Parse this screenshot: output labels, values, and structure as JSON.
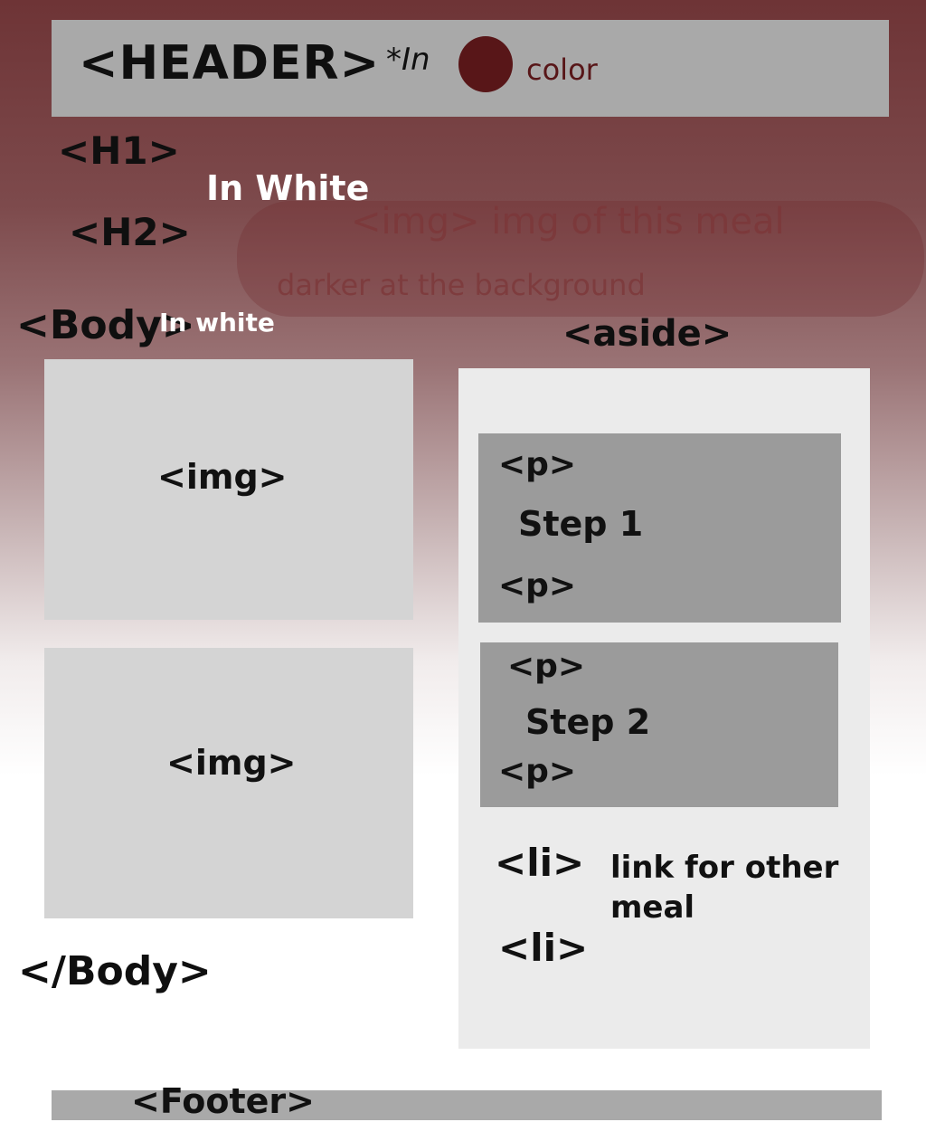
{
  "header": {
    "label": "<HEADER>",
    "note": "*In",
    "color_word": "color",
    "color_swatch": "#581618"
  },
  "headings": {
    "h1": "<H1>",
    "h2": "<H2>",
    "note": "In White"
  },
  "hero_note": {
    "line1": "<img> img of this meal",
    "line2": "darker at the background"
  },
  "body": {
    "open": "<Body>",
    "note": "In white",
    "close": "</Body>",
    "images": [
      {
        "label": "<img>"
      },
      {
        "label": "<img>"
      }
    ]
  },
  "aside": {
    "label": "<aside>",
    "steps": [
      {
        "p_open": "<p>",
        "text": "Step 1",
        "p_close": "<p>"
      },
      {
        "p_open": "<p>",
        "text": "Step 2",
        "p_close": "<p>"
      }
    ],
    "list": [
      {
        "tag": "<li>",
        "text": "link for other meal"
      },
      {
        "tag": "<li>",
        "text": ""
      }
    ]
  },
  "footer": {
    "label": "<Footer>"
  },
  "colors": {
    "background_top": "#6e3436",
    "accent": "#581618",
    "panel_gray": "#a9a9a9"
  }
}
